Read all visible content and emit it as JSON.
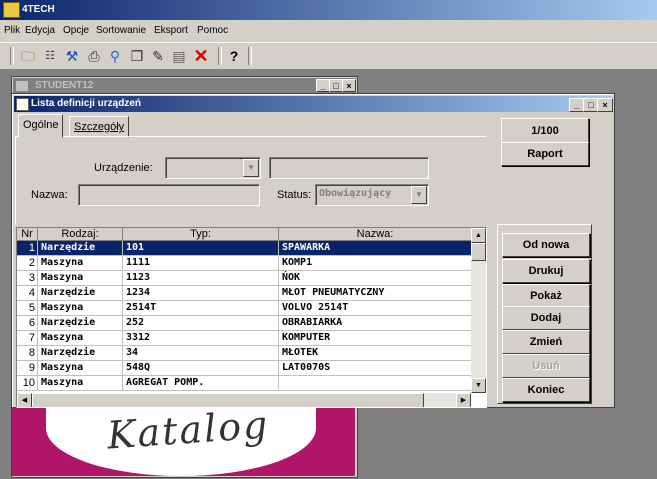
{
  "app": {
    "title": "4TECH"
  },
  "menu": [
    "Plik",
    "Edycja",
    "Opcje",
    "Sortowanie",
    "Eksport",
    "Pomoc"
  ],
  "toolbar_icons": [
    "open-icon",
    "list-icon",
    "tools-icon",
    "print-icon",
    "search-icon",
    "copy-icon",
    "edit-icon",
    "notes-icon",
    "delete-icon",
    "help-icon"
  ],
  "bg_window": {
    "title": "STUDENT12"
  },
  "catalog_text": "Katalog",
  "window": {
    "title": "Lista definicji urządzeń",
    "tabs": [
      "Ogólne",
      "Szczegóły"
    ],
    "labels": {
      "device": "Urządzenie:",
      "name": "Nazwa:",
      "status": "Status:"
    },
    "status_value": "Obowiązujący",
    "buttons_top": [
      "1/100",
      "Raport"
    ],
    "buttons_side": [
      "Od nowa",
      "Drukuj",
      "Pokaż",
      "Dodaj",
      "Zmień",
      "Usuń",
      "Koniec"
    ],
    "disabled": "Usuń"
  },
  "grid": {
    "headers": [
      "Nr",
      "Rodzaj:",
      "Typ:",
      "Nazwa:"
    ],
    "rows": [
      [
        "1",
        "Narzędzie",
        "101",
        "SPAWARKA"
      ],
      [
        "2",
        "Maszyna",
        "1111",
        "KOMP1"
      ],
      [
        "3",
        "Maszyna",
        "1123",
        "ŃOK"
      ],
      [
        "4",
        "Narzędzie",
        "1234",
        "MŁOT PNEUMATYCZNY"
      ],
      [
        "5",
        "Maszyna",
        "2514T",
        "VOLVO 2514T"
      ],
      [
        "6",
        "Narzędzie",
        "252",
        "OBRABIARKA"
      ],
      [
        "7",
        "Maszyna",
        "3312",
        "KOMPUTER"
      ],
      [
        "8",
        "Narzędzie",
        "34",
        "MŁOTEK"
      ],
      [
        "9",
        "Maszyna",
        "548Q",
        "LAT0070S"
      ],
      [
        "10",
        "Maszyna",
        "AGREGAT POMP.",
        ""
      ]
    ],
    "selected_row": 1
  }
}
